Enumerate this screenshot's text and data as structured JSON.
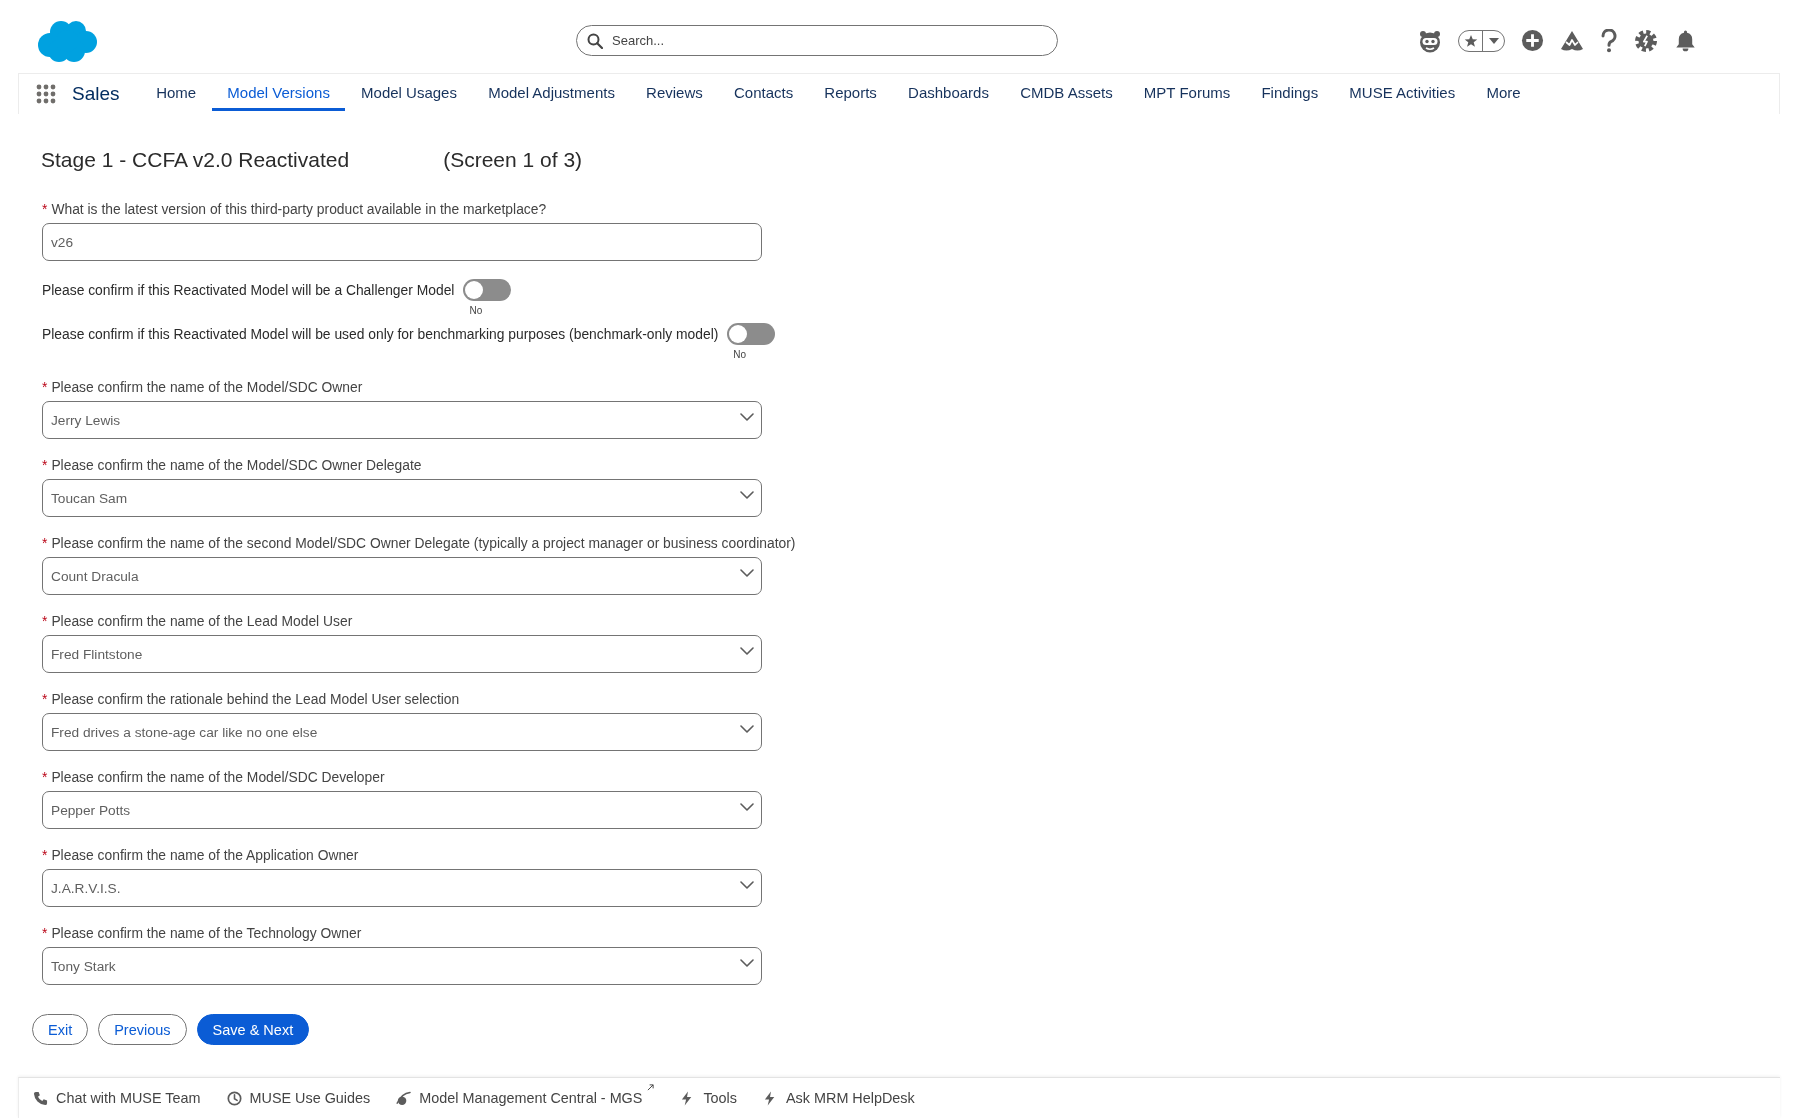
{
  "header": {
    "search": {
      "placeholder": "Search..."
    }
  },
  "nav": {
    "app_name": "Sales",
    "tabs": [
      {
        "label": "Home",
        "selected": false
      },
      {
        "label": "Model Versions",
        "selected": true
      },
      {
        "label": "Model Usages",
        "selected": false
      },
      {
        "label": "Model Adjustments",
        "selected": false
      },
      {
        "label": "Reviews",
        "selected": false
      },
      {
        "label": "Contacts",
        "selected": false
      },
      {
        "label": "Reports",
        "selected": false
      },
      {
        "label": "Dashboards",
        "selected": false
      },
      {
        "label": "CMDB Assets",
        "selected": false
      },
      {
        "label": "MPT Forums",
        "selected": false
      },
      {
        "label": "Findings",
        "selected": false
      },
      {
        "label": "MUSE Activities",
        "selected": false
      },
      {
        "label": "More",
        "selected": false
      }
    ]
  },
  "form": {
    "title": "Stage 1 - CCFA v2.0 Reactivated",
    "step": "(Screen 1 of 3)",
    "fields": [
      {
        "kind": "text",
        "required_mark": "*",
        "label": "What is the latest version of this third-party product available in the marketplace?",
        "value": "v26"
      },
      {
        "kind": "toggle",
        "label": "Please confirm if this Reactivated Model will be a Challenger Model",
        "on": false,
        "state_label": "No"
      },
      {
        "kind": "toggle",
        "label": "Please confirm if this Reactivated Model will be used only for benchmarking purposes (benchmark-only model)",
        "on": false,
        "state_label": "No"
      },
      {
        "kind": "select",
        "required_mark": "*",
        "label": "Please confirm the name of the Model/SDC Owner",
        "value": "Jerry Lewis"
      },
      {
        "kind": "select",
        "required_mark": "*",
        "label": "Please confirm the name of the Model/SDC Owner Delegate",
        "value": "Toucan Sam"
      },
      {
        "kind": "select",
        "required_mark": "*",
        "label": "Please confirm the name of the second Model/SDC Owner Delegate (typically a project manager or business coordinator)",
        "value": "Count Dracula"
      },
      {
        "kind": "select",
        "required_mark": "*",
        "label": "Please confirm the name of the Lead Model User",
        "value": "Fred Flintstone"
      },
      {
        "kind": "select",
        "required_mark": "*",
        "label": "Please confirm the rationale behind the Lead Model User selection",
        "value": "Fred drives a stone-age car like no one else"
      },
      {
        "kind": "select",
        "required_mark": "*",
        "label": "Please confirm the name of the Model/SDC Developer",
        "value": "Pepper Potts"
      },
      {
        "kind": "select",
        "required_mark": "*",
        "label": "Please confirm the name of the Application Owner",
        "value": "J.A.R.V.I.S."
      },
      {
        "kind": "select",
        "required_mark": "*",
        "label": "Please confirm the name of the Technology Owner",
        "value": "Tony Stark"
      }
    ],
    "buttons": [
      {
        "label": "Exit",
        "kind": "neutral"
      },
      {
        "label": "Previous",
        "kind": "neutral"
      },
      {
        "label": "Save & Next",
        "kind": "brand"
      }
    ]
  },
  "utility_bar": {
    "items": [
      {
        "label": "Chat with MUSE Team",
        "external": false
      },
      {
        "label": "MUSE Use Guides",
        "external": false
      },
      {
        "label": "Model Management Central - MGS",
        "external": true
      },
      {
        "label": "Tools",
        "external": false
      },
      {
        "label": "Ask MRM HelpDesk",
        "external": false
      }
    ]
  }
}
